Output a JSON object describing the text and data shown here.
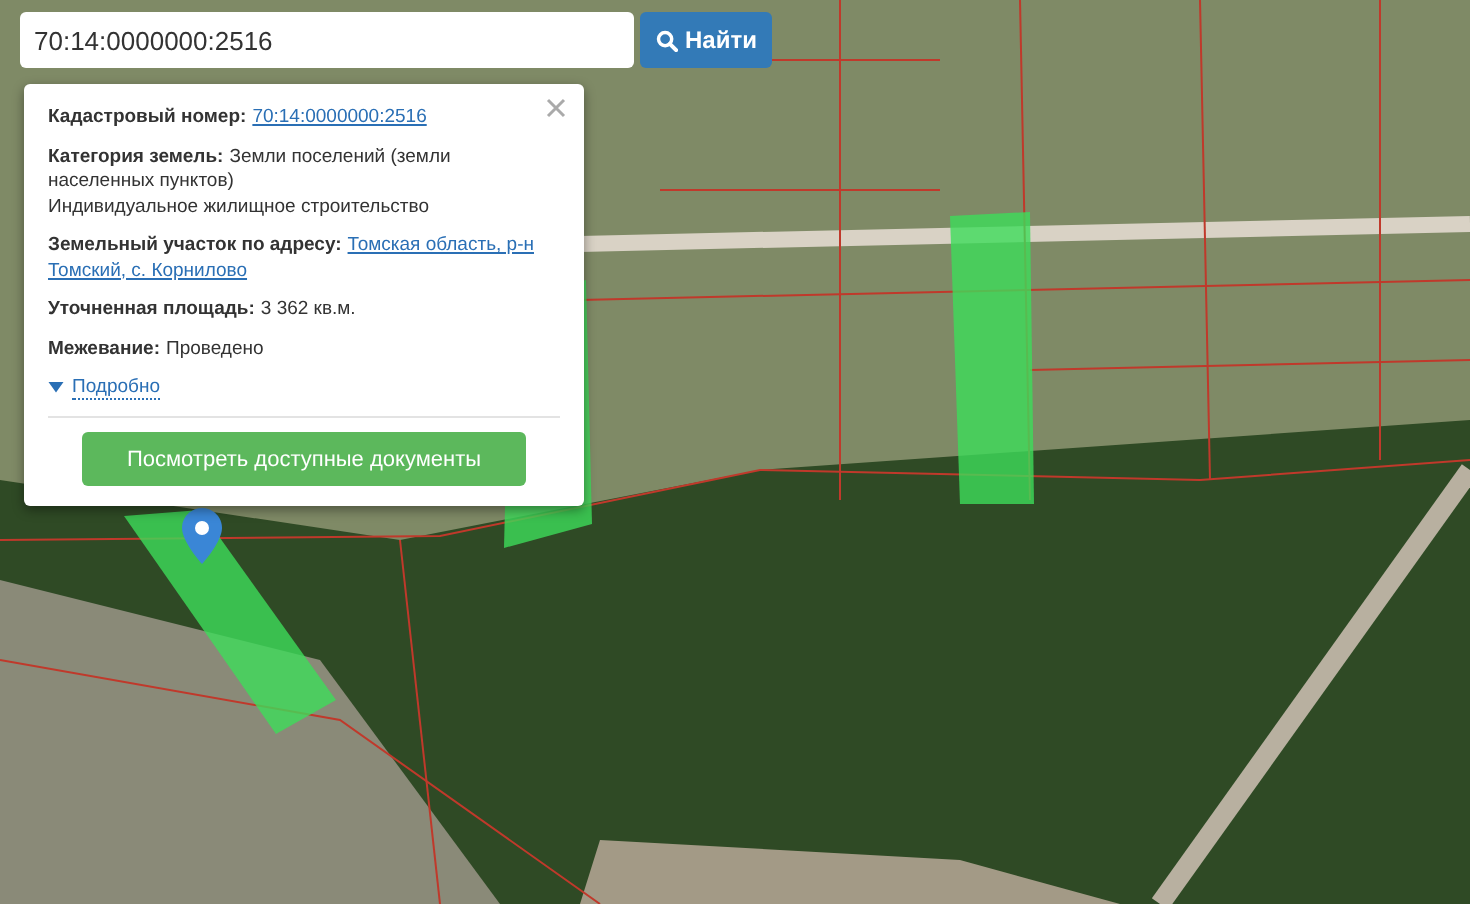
{
  "search": {
    "value": "70:14:0000000:2516",
    "button": "Найти"
  },
  "popup": {
    "fields": [
      {
        "label": "Кадастровый номер:",
        "lines": [
          "70:14:0000000:2516"
        ],
        "kind": "link"
      },
      {
        "label": "Категория земель:",
        "lines": [
          "Земли поселений (земли",
          "населенных пунктов)"
        ],
        "kind": "text",
        "extra": "Индивидуальное жилищное строительство"
      },
      {
        "label": "Земельный участок по адресу:",
        "lines": [
          "Томская область, р-н",
          "Томский, с. Корнилово"
        ],
        "kind": "link"
      },
      {
        "label": "Уточненная площадь:",
        "lines": [
          "3 362 кв.м."
        ],
        "kind": "text"
      },
      {
        "label": "Межевание:",
        "lines": [
          "Проведено"
        ],
        "kind": "text"
      }
    ],
    "details": {
      "label": "Подробно",
      "expanded": false
    },
    "button": "Посмотреть доступные документы"
  }
}
